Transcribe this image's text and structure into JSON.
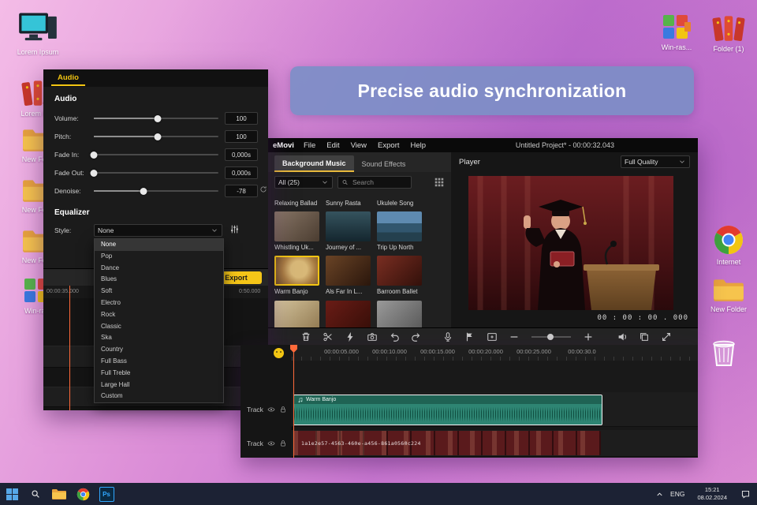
{
  "banner": {
    "title": "Precise audio synchronization"
  },
  "desktop": {
    "icons": [
      {
        "label": "Lorem Ipsum"
      },
      {
        "label": "Lorem Ip..."
      },
      {
        "label": "New Fol..."
      },
      {
        "label": "New Fol..."
      },
      {
        "label": "New Fol..."
      },
      {
        "label": "Win-ra..."
      },
      {
        "label": "Win-ras..."
      },
      {
        "label": "Folder (1)"
      },
      {
        "label": "Internet"
      },
      {
        "label": "New Folder"
      }
    ]
  },
  "app": {
    "logo": "eMovi",
    "menu": [
      "File",
      "Edit",
      "View",
      "Export",
      "Help"
    ],
    "title": "Untitled Project* - 00:00:32.043",
    "library": {
      "tab_active": "Background Music",
      "tab_inactive": "Sound Effects",
      "filter_value": "All (25)",
      "search_placeholder": "Search",
      "row0_labels": [
        "Relaxing Ballad",
        "Sunny Rasta",
        "Ukulele Song"
      ],
      "row1_labels": [
        "Whistling Uk...",
        "Journey of ...",
        "Trip Up North"
      ],
      "row2_labels": [
        "Warm Banjo",
        "Als Far In L...",
        "Barroom Ballet"
      ]
    },
    "player": {
      "title": "Player",
      "quality": "Full Quality",
      "timecode": "00 : 00 : 00 . 000"
    },
    "timeline": {
      "ruler": [
        "00:00:05.000",
        "00:00:10.000",
        "00:00:15.000",
        "00:00:20.000",
        "00:00:25.000",
        "00:00:30.0"
      ],
      "track_label": "Track",
      "audio_clip_name": "Warm Banjo",
      "video_clip_name": "1a1e2e57-4563-460e-a456-861a0560c224"
    }
  },
  "audio_panel": {
    "tab": "Audio",
    "sections": {
      "audio": "Audio",
      "equalizer": "Equalizer"
    },
    "sliders": [
      {
        "label": "Volume:",
        "value": "100",
        "pos": 51
      },
      {
        "label": "Pitch:",
        "value": "100",
        "pos": 51
      },
      {
        "label": "Fade In:",
        "value": "0,000s",
        "pos": 0
      },
      {
        "label": "Fade Out:",
        "value": "0,000s",
        "pos": 0
      },
      {
        "label": "Denoise:",
        "value": "-78",
        "pos": 40
      }
    ],
    "style_label": "Style:",
    "style_value": "None",
    "style_options": [
      "None",
      "Pop",
      "Dance",
      "Blues",
      "Soft",
      "Electro",
      "Rock",
      "Classic",
      "Ska",
      "Country",
      "Full Bass",
      "Full Treble",
      "Large Hall",
      "Custom"
    ],
    "export_label": "Export",
    "ruler_labels": [
      "00:00:35.000",
      "0:50.000"
    ]
  },
  "taskbar": {
    "language": "ENG",
    "time": "15:21",
    "date": "08.02.2024",
    "ps_label": "Ps"
  }
}
